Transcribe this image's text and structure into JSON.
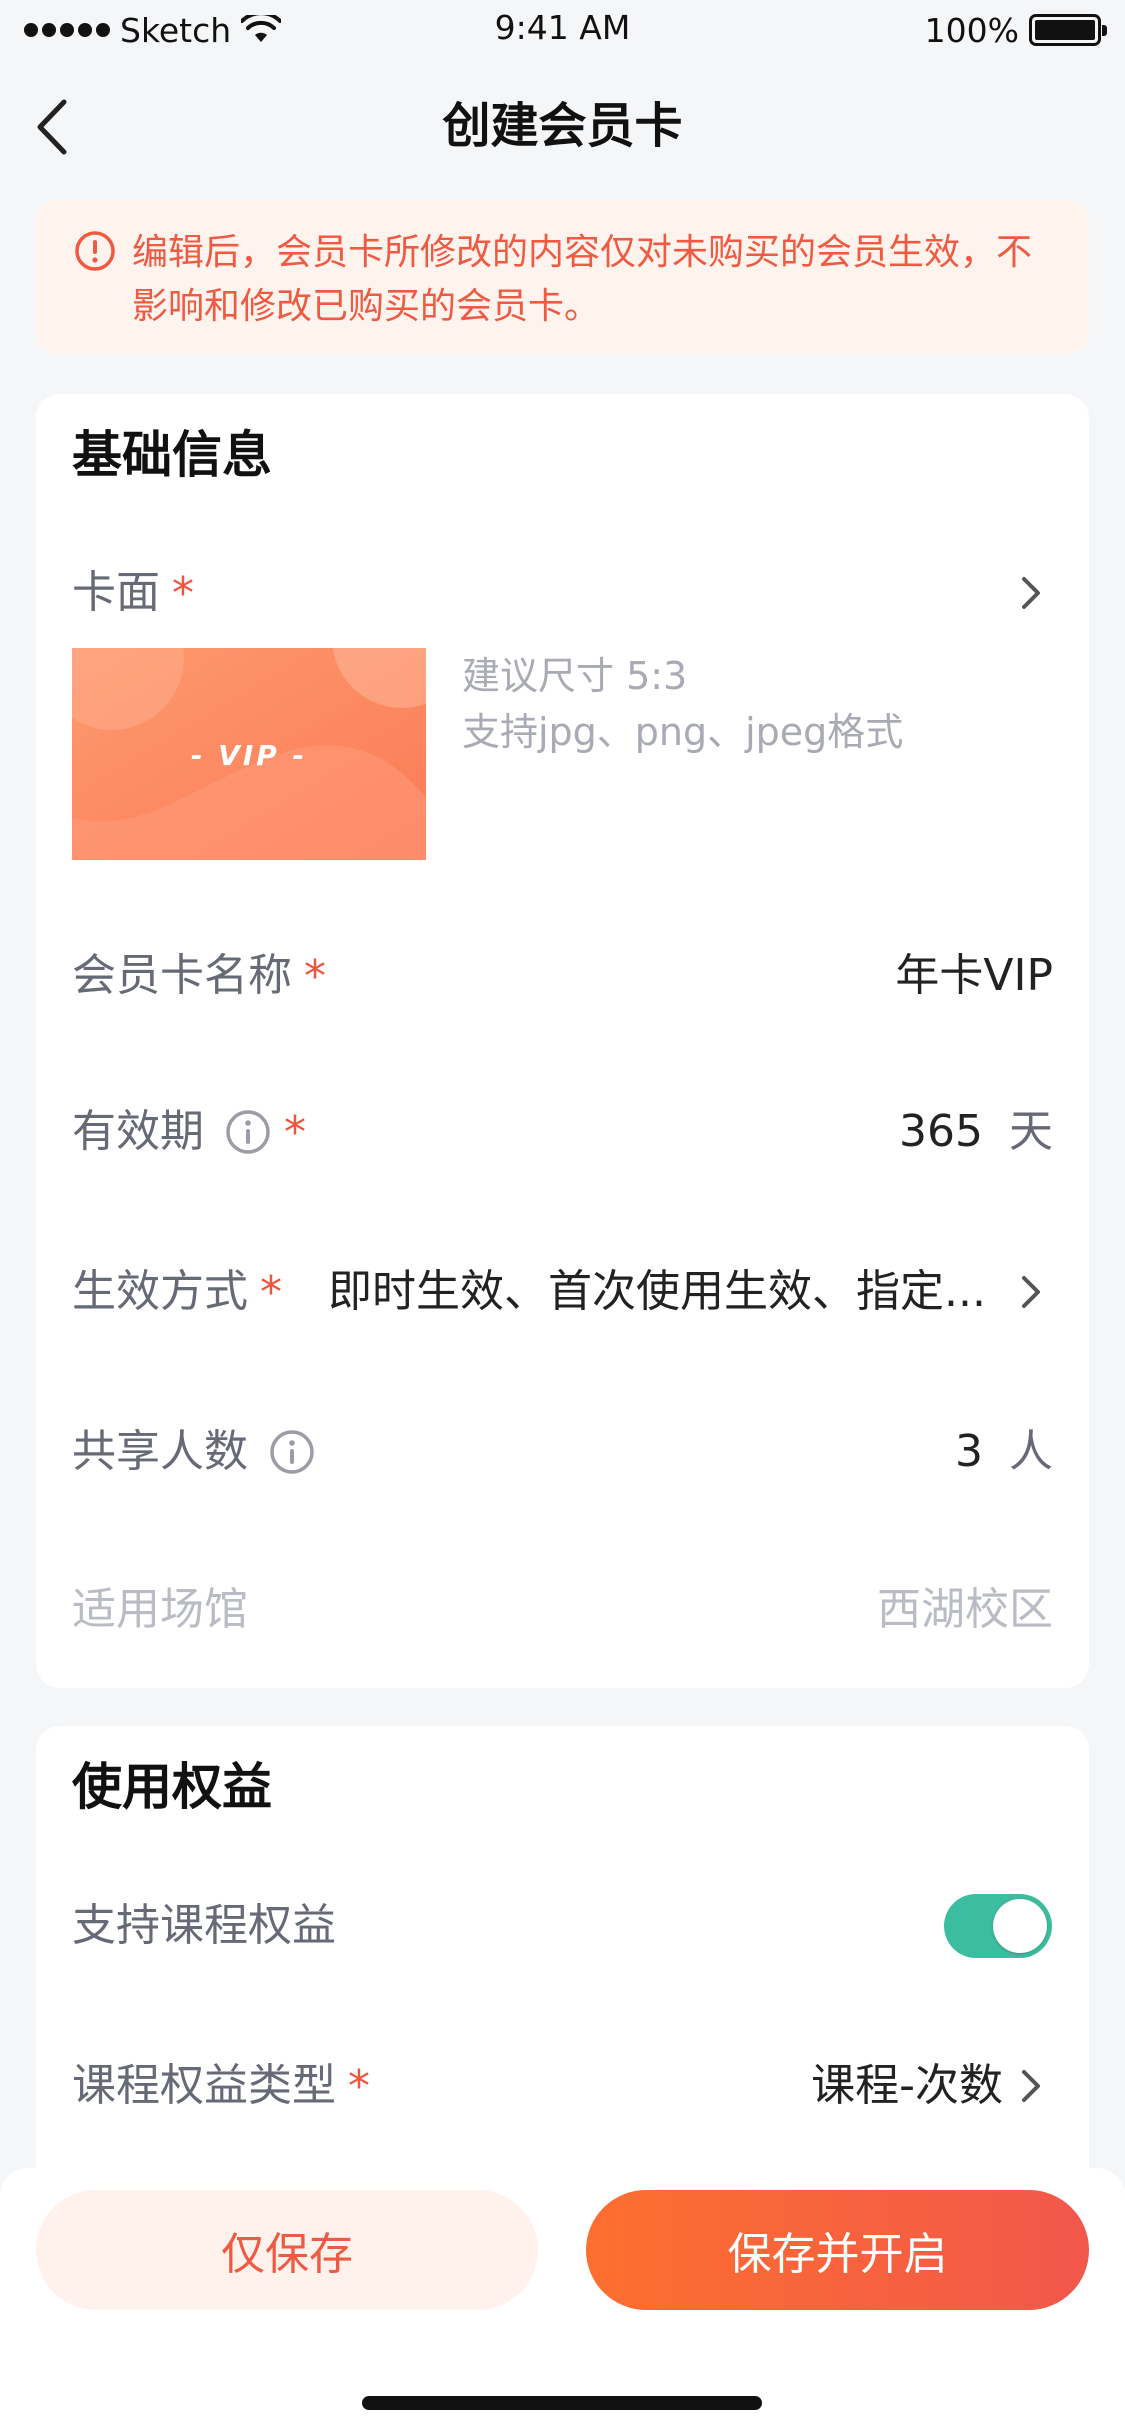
{
  "status_bar": {
    "carrier": "Sketch",
    "time": "9:41 AM",
    "battery": "100%"
  },
  "nav": {
    "title": "创建会员卡"
  },
  "banner": {
    "text": "编辑后，会员卡所修改的内容仅对未购买的会员生效，不影响和修改已购买的会员卡。"
  },
  "basic_info": {
    "title": "基础信息",
    "card_face": {
      "label": "卡面",
      "required_mark": "*",
      "image_text": "- VIP -",
      "hint_size": "建议尺寸 5:3",
      "hint_formats": "支持jpg、png、jpeg格式"
    },
    "card_name": {
      "label": "会员卡名称",
      "required_mark": "*",
      "value": "年卡VIP"
    },
    "validity": {
      "label": "有效期",
      "required_mark": "*",
      "value": "365",
      "unit": "天"
    },
    "effect_mode": {
      "label": "生效方式",
      "required_mark": "*",
      "value": "即时生效、首次使用生效、指定..."
    },
    "share_count": {
      "label": "共享人数",
      "value": "3",
      "unit": "人"
    },
    "venue": {
      "label": "适用场馆",
      "value": "西湖校区"
    }
  },
  "benefits": {
    "title": "使用权益",
    "course_support": {
      "label": "支持课程权益",
      "enabled": true
    },
    "course_type": {
      "label": "课程权益类型",
      "required_mark": "*",
      "value": "课程-次数"
    }
  },
  "actions": {
    "save_only": "仅保存",
    "save_and_open": "保存并开启"
  },
  "colors": {
    "accent": "#f0543a",
    "banner_bg": "#fff3ee",
    "toggle_on": "#3dbd9f",
    "gradient_start": "#fd6f2f",
    "gradient_end": "#f2574b"
  },
  "icons": [
    "signal-dots-icon",
    "wifi-icon",
    "battery-icon",
    "back-chevron-icon",
    "alert-circle-icon",
    "info-circle-icon",
    "chevron-right-icon"
  ]
}
